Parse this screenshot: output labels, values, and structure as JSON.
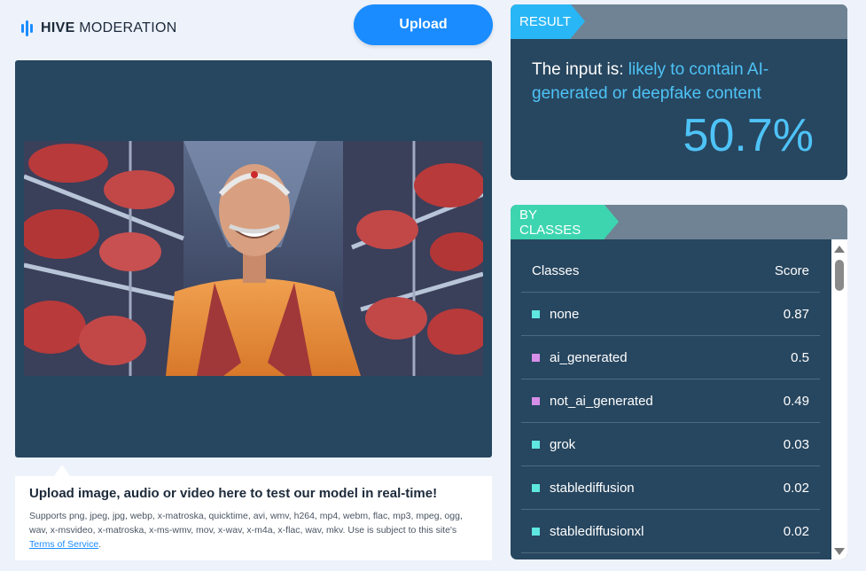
{
  "brand": {
    "name_bold": "HIVE",
    "name_light": "MODERATION",
    "icon": "hive-logo-icon"
  },
  "upload_button": {
    "label": "Upload"
  },
  "info": {
    "title": "Upload image, audio or video here to test our model in real-time!",
    "body": "Supports png, jpeg, jpg, webp, x-matroska, quicktime, avi, wmv, h264, mp4, webm, flac, mp3, mpeg, ogg, wav, x-msvideo, x-matroska, x-ms-wmv, mov, x-wav, x-m4a, x-flac, wav, mkv. Use is subject to this site's ",
    "link_text": "Terms of Service",
    "end": "."
  },
  "result": {
    "tag": "RESULT",
    "prefix": "The input is: ",
    "verdict": "likely to contain AI-generated or deepfake content",
    "percentage": "50.7%"
  },
  "classes": {
    "tag": "BY CLASSES",
    "col_class": "Classes",
    "col_score": "Score",
    "rows": [
      {
        "name": "none",
        "score": "0.87",
        "color": "#5ee8e0"
      },
      {
        "name": "ai_generated",
        "score": "0.5",
        "color": "#d78ee8"
      },
      {
        "name": "not_ai_generated",
        "score": "0.49",
        "color": "#d78ee8"
      },
      {
        "name": "grok",
        "score": "0.03",
        "color": "#5ee8e0"
      },
      {
        "name": "stablediffusion",
        "score": "0.02",
        "color": "#5ee8e0"
      },
      {
        "name": "stablediffusionxl",
        "score": "0.02",
        "color": "#5ee8e0"
      }
    ]
  },
  "colors": {
    "accent": "#1a8cff",
    "panel": "#27465f",
    "result_tag": "#29b6f6",
    "classes_tag": "#3dd5b0"
  }
}
